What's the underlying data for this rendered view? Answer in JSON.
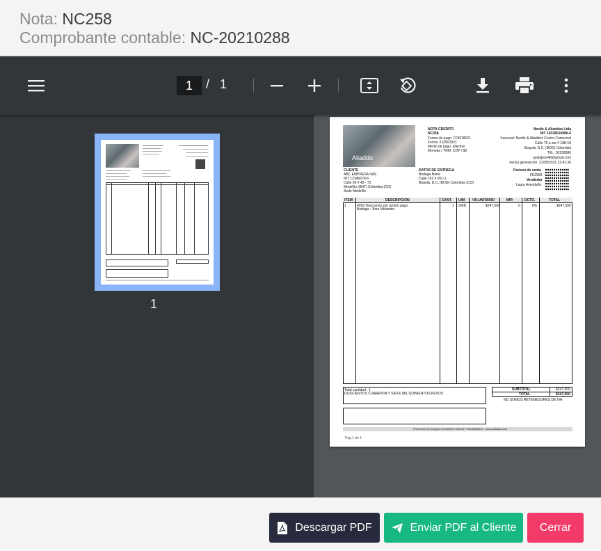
{
  "header": {
    "nota_label": "Nota:",
    "nota_value": "NC258",
    "comprobante_label": "Comprobante contable:",
    "comprobante_value": "NC-20210288"
  },
  "toolbar": {
    "current_page": "1",
    "separator": "/",
    "total_pages": "1"
  },
  "sidebar": {
    "thumbnail_number": "1"
  },
  "document": {
    "title": "NOTA CREDITO",
    "number": "NC258",
    "forma_pago": "Forma de pago: CONTADO",
    "fecha": "Fecha: 21/05/2021",
    "medio_pago": "Medio de pago: Efectivo",
    "moneda": "Moneda / TRM: COP / $0",
    "company_name": "Nestle & Aliaddos Ltda",
    "company_nit": "NIT 10338010080-6",
    "company_sucursal": "Sucursal: Nestle & Aliaddos Centro Comercial",
    "company_address": "Calle 79 a sur # 188-18",
    "company_city": "Bogotá, D.C. (BOG) Colombia",
    "company_tel": "TEL: 30158986",
    "company_email": "ayalajhon40@gmail.com",
    "fecha_generacion": "Fecha generación: 21/05/2021 12:41:36",
    "logo_text": "Aliaddo",
    "cliente_title": "CLIENTE",
    "cliente_name": "ABC EMPRESA SAS",
    "cliente_nit": "NIT 12345678-6",
    "cliente_address": "Calle 06 # 43 - 72",
    "cliente_city": "Medellín (ANT) Colombia (CO)",
    "cliente_sede": "Sede Medellín",
    "entrega_title": "DATOS DE ENTREGA",
    "entrega_bodega": "Bodega Norte",
    "entrega_address": "Calle 101 # 001-3",
    "entrega_city": "Bogotá, D.C. (BOG) Colombia (CO)",
    "factura_label": "Factura de venta",
    "factura_value": "FE2983",
    "vendedor_label": "Vendedor",
    "vendedor_value": "Laura Avendaño",
    "table_headers": [
      "ITEM",
      "DESCRIPCIÓN",
      "CANT.",
      "U/M",
      "VR.UNITARIO",
      "IMP.",
      "DCTO.",
      "TOTAL"
    ],
    "row": {
      "item": "1",
      "desc1": "4955 Descuento por pronto pago",
      "desc2": "Bodega : Jhon Melambo",
      "cant": "1",
      "um": "UNID",
      "vr_unitario": "$247,500",
      "imp": "0",
      "dcto": "0%",
      "total": "$247,500"
    },
    "total_cantidad": "Total cantidad : 1",
    "total_letras": "DOSCIENTOS CUARENTA Y SIETE MIL QUINIENTOS  PESOS",
    "subtotal_label": "SUBTOTAL",
    "subtotal_value": "$247,500",
    "total_label": "TOTAL",
    "total_value": "$247,500",
    "retenedores": "NO SOMOS RETENEDORES DE IVA",
    "proveedor": "Proveedor Tecnológico    ALIADDO SAS NIT 901089806-0  -  www.aliaddo.com",
    "pagina": "Pág  1  de   1"
  },
  "footer": {
    "download_label": "Descargar PDF",
    "send_label": "Enviar PDF al Cliente",
    "close_label": "Cerrar"
  },
  "colors": {
    "toolbar_bg": "#323639",
    "viewer_bg": "#525659",
    "thumb_highlight": "#8ab4f8",
    "download_btn": "#282b3d",
    "send_btn": "#17b884",
    "close_btn": "#f23b69"
  }
}
